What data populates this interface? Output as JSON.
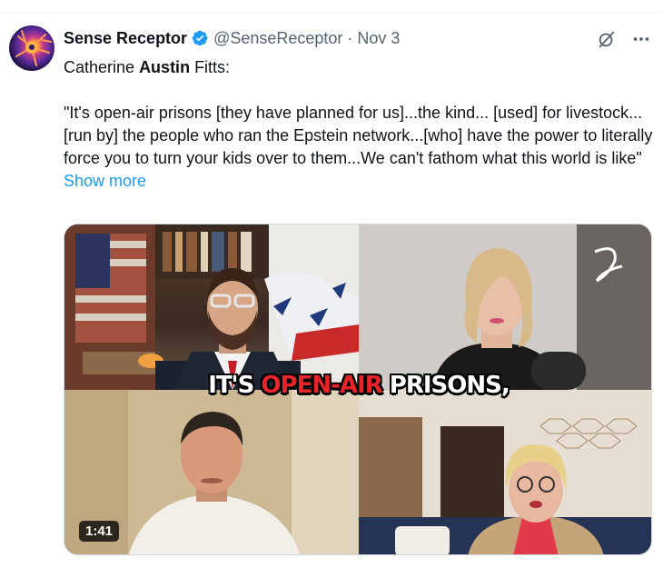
{
  "author": {
    "name": "Sense Receptor",
    "handle": "@SenseReceptor",
    "separator": "·",
    "date": "Nov 3",
    "verified_color": "#1d9bf0"
  },
  "tweet": {
    "name_plain": "Catherine ",
    "name_bold": "Austin",
    "name_suffix": " Fitts:",
    "quote": "\"It's open-air prisons [they have planned for us]...the kind... [used] for livestock...[run by] the people who ran the Epstein network...[who] have the power to literally force you to turn your kids over to them...We can't fathom what this world is like\"",
    "show_more": "Show more"
  },
  "video": {
    "caption_white_1": "IT'S ",
    "caption_red": "OPEN-AIR",
    "caption_white_2": " PRISONS,",
    "duration": "1:41"
  },
  "icons": {
    "avatar": "neuron-avatar",
    "verified": "verified-badge-icon",
    "grok": "grok-icon",
    "more": "more-icon"
  }
}
